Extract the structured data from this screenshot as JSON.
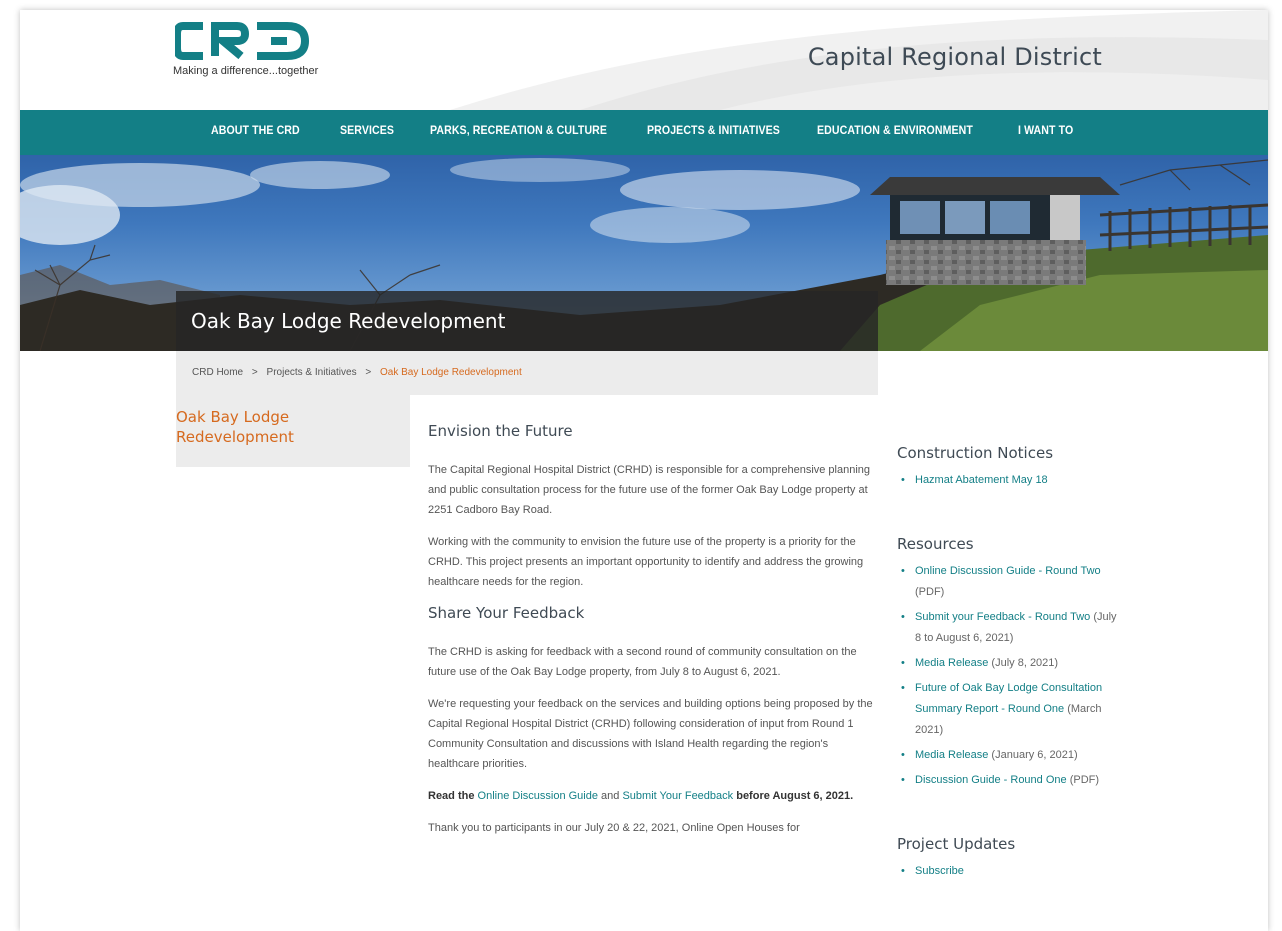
{
  "header": {
    "logo_text": "CRD",
    "tagline": "Making a difference...together",
    "site_title": "Capital Regional District"
  },
  "nav": {
    "items": [
      {
        "label": "ABOUT THE CRD"
      },
      {
        "label": "SERVICES"
      },
      {
        "label": "PARKS, RECREATION & CULTURE"
      },
      {
        "label": "PROJECTS & INITIATIVES"
      },
      {
        "label": "EDUCATION & ENVIRONMENT"
      },
      {
        "label": "I WANT TO"
      }
    ]
  },
  "hero": {
    "title": "Oak Bay Lodge Redevelopment"
  },
  "breadcrumb": {
    "items": [
      "CRD Home",
      "Projects & Initiatives",
      "Oak Bay Lodge Redevelopment"
    ],
    "separator": ">"
  },
  "leftnav": {
    "title": "Oak Bay Lodge Redevelopment"
  },
  "main": {
    "heading1": "Envision the Future",
    "p1": "The Capital Regional Hospital District (CRHD) is responsible for a comprehensive planning and public consultation process for the future use of the former Oak Bay Lodge property at 2251 Cadboro Bay Road.",
    "p2": "Working with the community to envision the future use of the property is a priority for the CRHD. This project presents an important opportunity to identify and address the growing healthcare needs for the region.",
    "heading2": "Share Your Feedback",
    "p3": "The CRHD is asking for feedback with a second round of community consultation on the future use of the Oak Bay Lodge property, from July 8 to August 6, 2021.",
    "p4": "We're requesting your feedback on the services and building options being proposed by the Capital Regional Hospital District (CRHD) following consideration of input from Round 1 Community Consultation and discussions with Island Health regarding the region's healthcare priorities.",
    "p5": {
      "read_the": "Read the",
      "link1": "Online Discussion Guide",
      "and": "and",
      "link2": "Submit Your Feedback",
      "before": "before August 6, 2021."
    },
    "p6": "Thank you to participants in our July 20 & 22, 2021, Online Open Houses for"
  },
  "sidebar": {
    "construction": {
      "title": "Construction Notices",
      "items": [
        {
          "link": "Hazmat Abatement May 18",
          "suffix": ""
        }
      ]
    },
    "resources": {
      "title": "Resources",
      "items": [
        {
          "link": "Online Discussion Guide - Round Two",
          "suffix": " (PDF)"
        },
        {
          "link": "Submit your Feedback - Round Two",
          "suffix": " (July 8 to August 6, 2021)"
        },
        {
          "link": "Media Release",
          "suffix": " (July 8, 2021)"
        },
        {
          "link": "Future of Oak Bay Lodge Consultation Summary Report - Round One",
          "suffix": " (March 2021)"
        },
        {
          "link": "Media Release",
          "suffix": " (January 6, 2021)"
        },
        {
          "link": "Discussion Guide - Round One",
          "suffix": " (PDF)"
        }
      ]
    },
    "updates": {
      "title": "Project Updates",
      "items": [
        {
          "link": "Subscribe",
          "suffix": ""
        }
      ]
    }
  },
  "colors": {
    "teal": "#137f86",
    "orange": "#d66a1f",
    "gray_panel": "#ececec"
  }
}
